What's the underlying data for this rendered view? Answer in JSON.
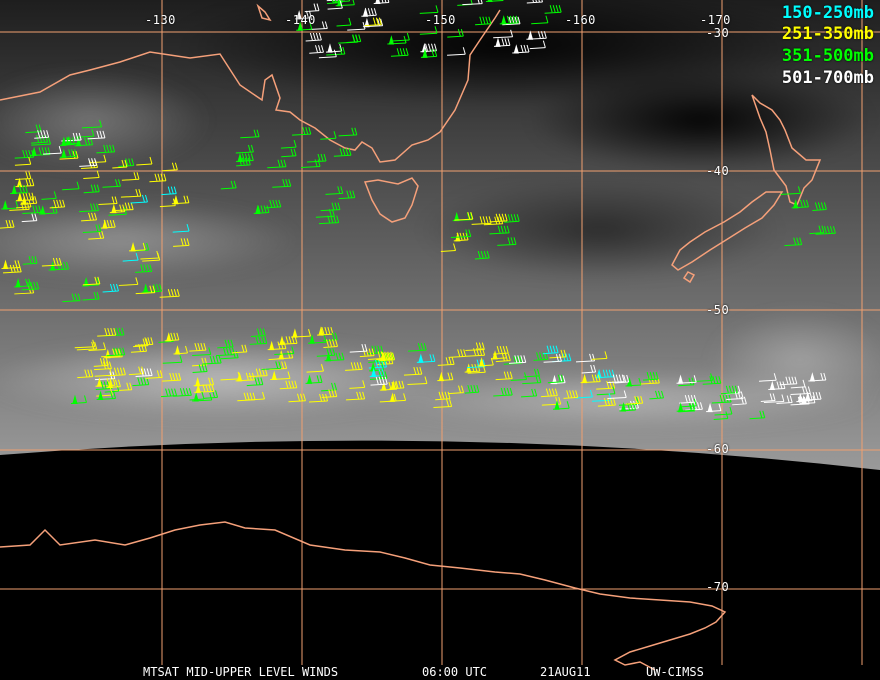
{
  "map": {
    "longitude_labels": [
      "-130",
      "-140",
      "-150",
      "-160",
      "-170"
    ],
    "latitude_labels": [
      "-30",
      "-40",
      "-50",
      "-60",
      "-70"
    ],
    "legend": [
      {
        "label": "150-250mb",
        "color": "#00ffff"
      },
      {
        "label": "251-350mb",
        "color": "#ffff00"
      },
      {
        "label": "351-500mb",
        "color": "#00ff00"
      },
      {
        "label": "501-700mb",
        "color": "#ffffff"
      }
    ],
    "footer": {
      "product": "MTSAT MID-UPPER LEVEL WINDS",
      "time": "06:00 UTC",
      "date": "21AUG11",
      "source": "UW-CIMSS"
    },
    "colors": {
      "coastline": "#f5a07a",
      "grid": "#f0a070",
      "space": "#000000"
    }
  }
}
